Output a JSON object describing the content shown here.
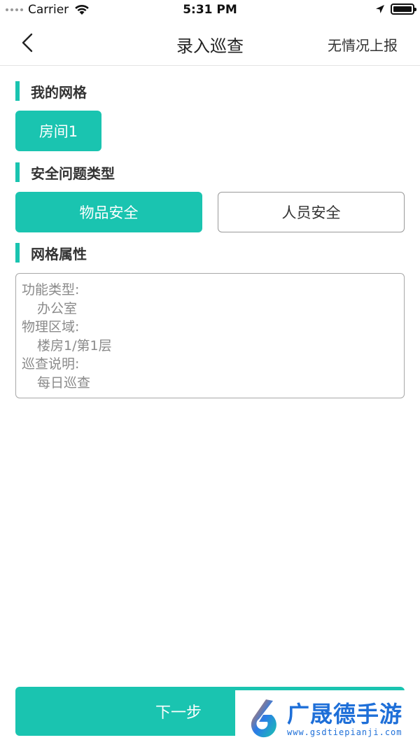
{
  "status_bar": {
    "carrier": "Carrier",
    "time": "5:31 PM",
    "icons": [
      "signal-icon",
      "wifi-icon",
      "location-arrow-icon",
      "battery-icon"
    ]
  },
  "nav": {
    "title": "录入巡查",
    "action": "无情况上报",
    "back_icon": "chevron-left-icon"
  },
  "grid_section": {
    "title": "我的网格",
    "chip": "房间1"
  },
  "issue_section": {
    "title": "安全问题类型",
    "options": [
      {
        "label": "物品安全",
        "selected": true
      },
      {
        "label": "人员安全",
        "selected": false
      }
    ]
  },
  "attr_section": {
    "title": "网格属性",
    "properties": [
      {
        "label": "功能类型:",
        "value": "办公室"
      },
      {
        "label": "物理区域:",
        "value": "楼房1/第1层"
      },
      {
        "label": "巡查说明:",
        "value": "每日巡查"
      }
    ]
  },
  "footer": {
    "next_label": "下一步"
  },
  "watermark": {
    "name": "广晟德手游",
    "url": "www.gsdtiepianji.com"
  },
  "colors": {
    "accent": "#1ac4b0",
    "watermark": "#1e6fd8"
  }
}
